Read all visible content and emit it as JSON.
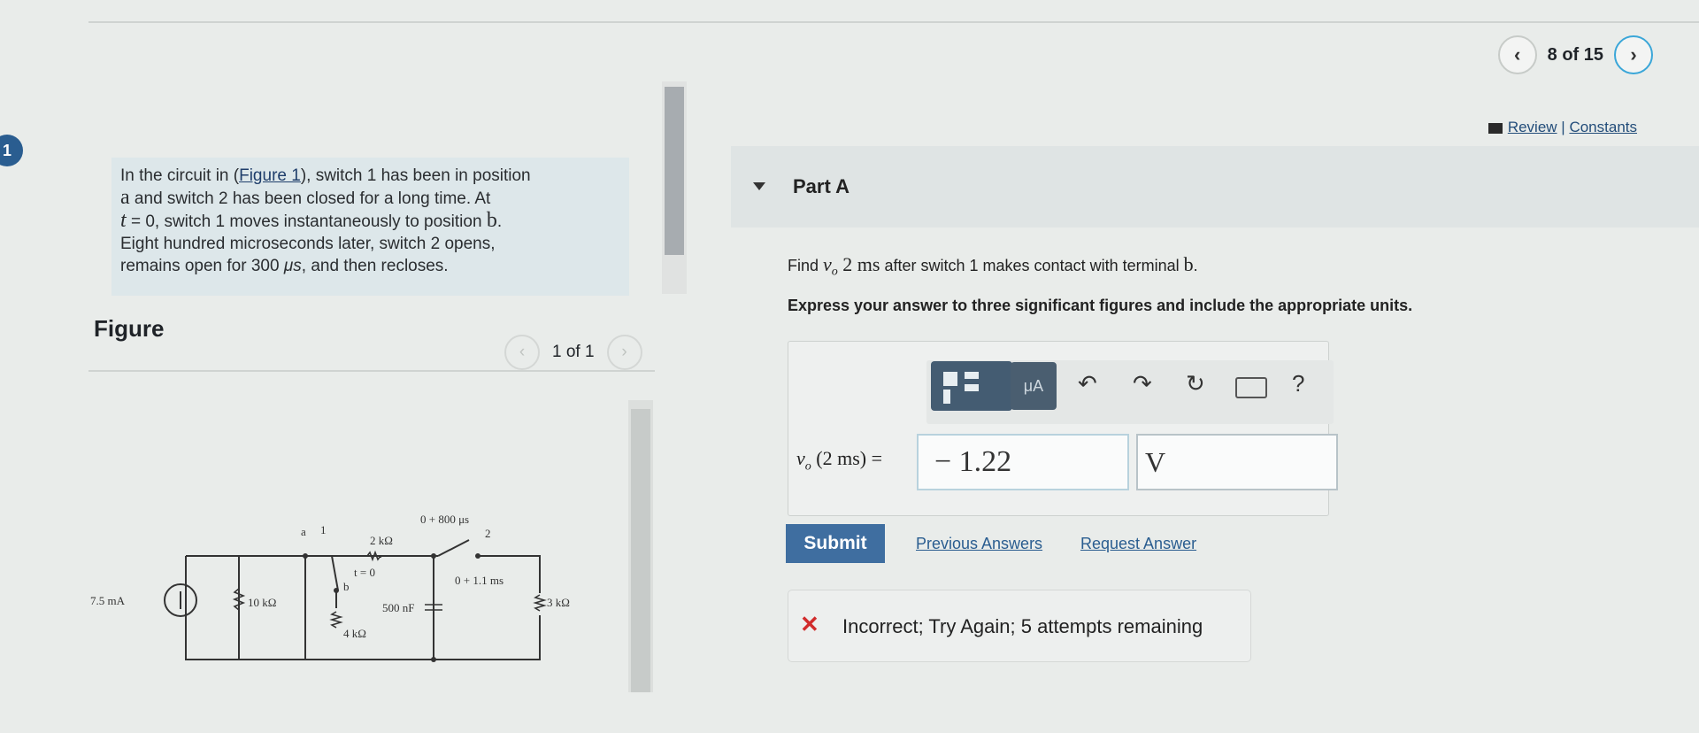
{
  "nav": {
    "counter": "8 of 15"
  },
  "header_links": {
    "review": "Review",
    "separator": "|",
    "constants": "Constants"
  },
  "badge": "1",
  "problem": {
    "t1": "In the circuit in (",
    "figure_link": "Figure 1",
    "t2": "), switch 1 has been in position",
    "pos_a": "a",
    "t3": " and switch 2 has been closed for a long time. At",
    "t_var": "t",
    "t4": " = 0, switch 1 moves instantaneously to position ",
    "pos_b": "b",
    "t5": ".",
    "t6": "Eight hundred microseconds later, switch 2 opens,",
    "t7": "remains open for 300 ",
    "unit_us": "μs",
    "t8": ", and then recloses."
  },
  "figure": {
    "label": "Figure",
    "pager": "1 of 1",
    "circuit": {
      "source": "7.5 mA",
      "r1": "10 kΩ",
      "r2": "2 kΩ",
      "r3": "4 kΩ",
      "cap": "500 nF",
      "r4": "3 kΩ",
      "node_a": "a",
      "sw1": "1",
      "node_b": "b",
      "t0": "t = 0",
      "sw2_label": "0 + 800 μs",
      "sw2": "2",
      "sw2_close": "0 + 1.1 ms"
    }
  },
  "part": {
    "title": "Part A",
    "q1": "Find ",
    "q_var": "v",
    "q_sub": "o",
    "q2": " 2 ",
    "q_unit": "ms",
    "q3": " after switch 1 makes contact with terminal ",
    "q_term": "b",
    "q4": ".",
    "express": "Express your answer to three significant figures and include the appropriate units."
  },
  "toolbar": {
    "units_btn": "μA",
    "undo": "↶",
    "redo": "↷",
    "reset": "↻",
    "help": "?"
  },
  "answer": {
    "label_var": "v",
    "label_sub": "o",
    "label_rest": " (2 ms) =",
    "value": "− 1.22",
    "unit": "V"
  },
  "actions": {
    "submit": "Submit",
    "previous": "Previous Answers",
    "request": "Request Answer"
  },
  "feedback": {
    "icon": "✕",
    "text": "Incorrect; Try Again; 5 attempts remaining"
  }
}
